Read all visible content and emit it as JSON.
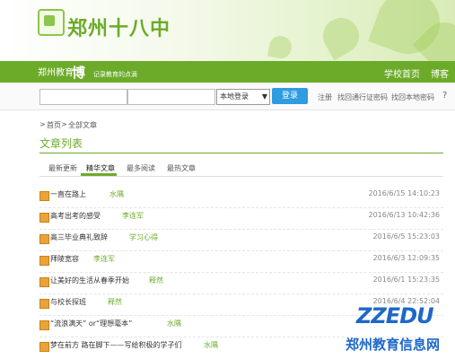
{
  "header": {
    "school_name": "郑州十八中"
  },
  "nav": {
    "blog_logo_main": "郑州教育",
    "blog_logo_big": "博客",
    "blog_logo_tagline": "记录教育的点滴",
    "links": [
      "学校首页",
      "博客"
    ]
  },
  "toolbar": {
    "username_placeholder": "",
    "password_placeholder": "",
    "select_value": "本地登录",
    "login_label": "登录",
    "links": [
      "注册",
      "找回通行证密码",
      "找回本地密码"
    ]
  },
  "breadcrumb": {
    "items": [
      "首页",
      "全部文章"
    ],
    "separator": ">"
  },
  "section": {
    "title": "文章列表"
  },
  "tabs": [
    "最新更新",
    "精华文章",
    "最多阅读",
    "最热文章"
  ],
  "articles": [
    {
      "title": "一直在路上",
      "author": "水隅",
      "date": "2016/6/15 14:10:23"
    },
    {
      "title": "高考出考的感受",
      "author": "李连军",
      "date": "2016/6/13 10:42:36"
    },
    {
      "title": "高三毕业典礼致辞",
      "author": "学习心得",
      "date": "2016/6/5 15:23:03"
    },
    {
      "title": "拜陵宽容",
      "author": "李连军",
      "date": "2016/6/3 12:09:35"
    },
    {
      "title": "让美好的生活从春季开始",
      "author": "释然",
      "date": "2016/6/1 15:23:35"
    },
    {
      "title": "与校长探班",
      "author": "释然",
      "date": "2016/6/4 22:52:04"
    },
    {
      "title": "“流浪满天”  or“理想毫本”",
      "author": "水隅",
      "date": ""
    },
    {
      "title": "梦在前方 路在脚下——写给积极的学子们",
      "author": "水隅",
      "date": ""
    }
  ],
  "watermark": {
    "logo": "ZZEDU",
    "text": "郑州教育信息网"
  },
  "colors": {
    "brand_green": "#6cab2a",
    "login_blue": "#2f9be0",
    "watermark_blue": "#1e68c8"
  }
}
